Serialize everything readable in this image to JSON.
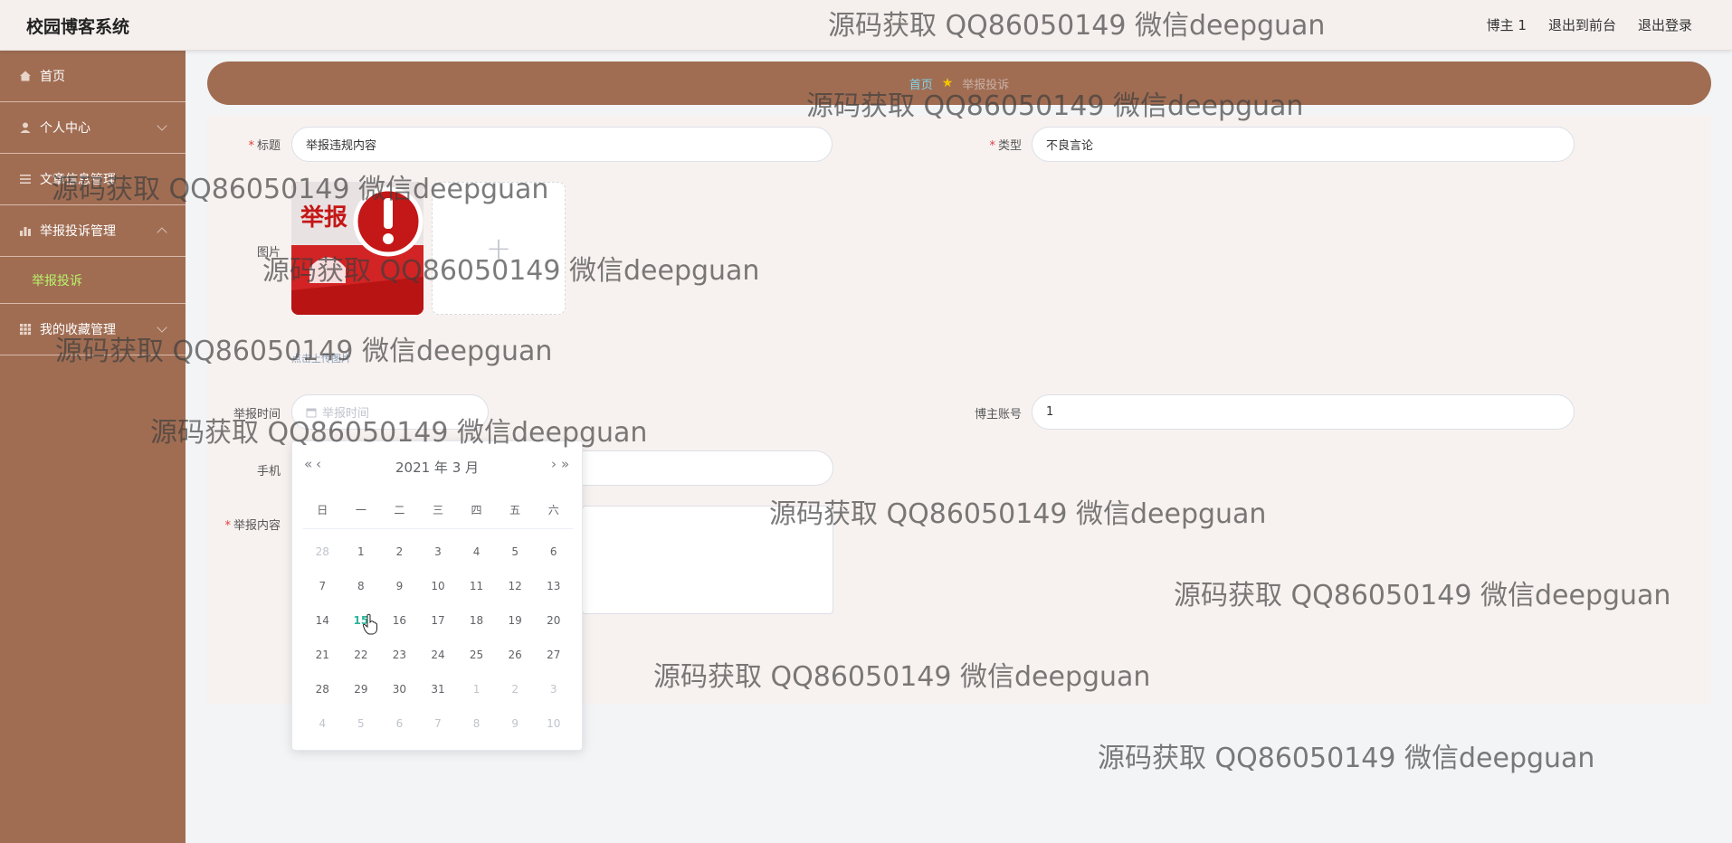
{
  "header": {
    "brand": "校园博客系统",
    "user": "博主 1",
    "to_front": "退出到前台",
    "logout": "退出登录"
  },
  "sidebar": {
    "items": [
      {
        "label": "首页",
        "icon": "home-icon"
      },
      {
        "label": "个人中心",
        "icon": "user-icon"
      },
      {
        "label": "文章信息管理",
        "icon": "list-icon"
      },
      {
        "label": "举报投诉管理",
        "icon": "chart-icon"
      },
      {
        "label": "我的收藏管理",
        "icon": "grid-icon"
      }
    ],
    "active_sub": "举报投诉"
  },
  "breadcrumb": {
    "home": "首页",
    "current": "举报投诉"
  },
  "form": {
    "title_label": "标题",
    "title_value": "举报违规内容",
    "type_label": "类型",
    "type_value": "不良言论",
    "image_label": "图片",
    "upload_tip": "点击上传图片",
    "image_text": "举报",
    "time_label": "举报时间",
    "time_placeholder": "举报时间",
    "account_label": "博主账号",
    "account_value": "1",
    "phone_label": "手机",
    "content_label": "举报内容"
  },
  "datepicker": {
    "year_month": "2021 年  3 月",
    "weekdays": [
      "日",
      "一",
      "二",
      "三",
      "四",
      "五",
      "六"
    ],
    "days": [
      "28",
      "1",
      "2",
      "3",
      "4",
      "5",
      "6",
      "7",
      "8",
      "9",
      "10",
      "11",
      "12",
      "13",
      "14",
      "15",
      "16",
      "17",
      "18",
      "19",
      "20",
      "21",
      "22",
      "23",
      "24",
      "25",
      "26",
      "27",
      "28",
      "29",
      "30",
      "31",
      "1",
      "2",
      "3",
      "4",
      "5",
      "6",
      "7",
      "8",
      "9",
      "10"
    ],
    "today": "15"
  },
  "watermark": "源码获取 QQ86050149 微信deepguan",
  "colors": {
    "sidebar": "#a06d53",
    "accent_sub": "#b9f26a",
    "today": "#2bb59a"
  }
}
